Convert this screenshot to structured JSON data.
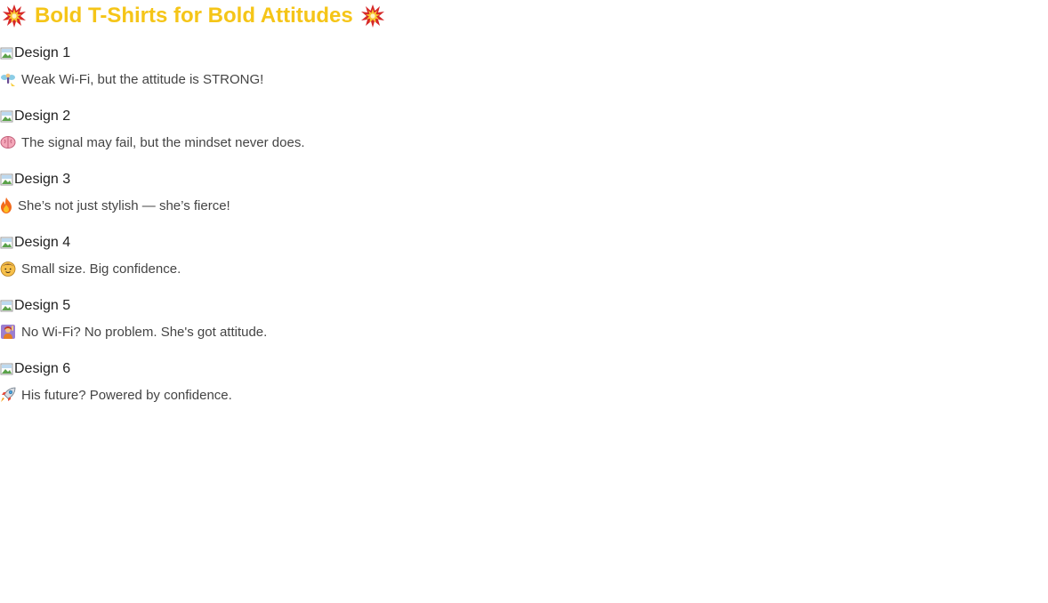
{
  "header": {
    "title": "Bold T-Shirts for Bold Attitudes",
    "left_icon": "collision-burst-icon",
    "right_icon": "collision-burst-icon",
    "title_color": "#f5c518"
  },
  "designs": [
    {
      "image_alt": "Design 1",
      "caption_icon": "fairy-wings-icon",
      "caption": "Weak Wi-Fi, but the attitude is STRONG!"
    },
    {
      "image_alt": "Design 2",
      "caption_icon": "brain-icon",
      "caption": "The signal may fail, but the mindset never does."
    },
    {
      "image_alt": "Design 3",
      "caption_icon": "fire-icon",
      "caption": "She’s not just stylish — she’s fierce!"
    },
    {
      "image_alt": "Design 4",
      "caption_icon": "child-face-icon",
      "caption": "Small size. Big confidence."
    },
    {
      "image_alt": "Design 5",
      "caption_icon": "person-raising-hand-icon",
      "caption": "No Wi-Fi? No problem. She's got attitude."
    },
    {
      "image_alt": "Design 6",
      "caption_icon": "rocket-icon",
      "caption": "His future? Powered by confidence."
    }
  ]
}
